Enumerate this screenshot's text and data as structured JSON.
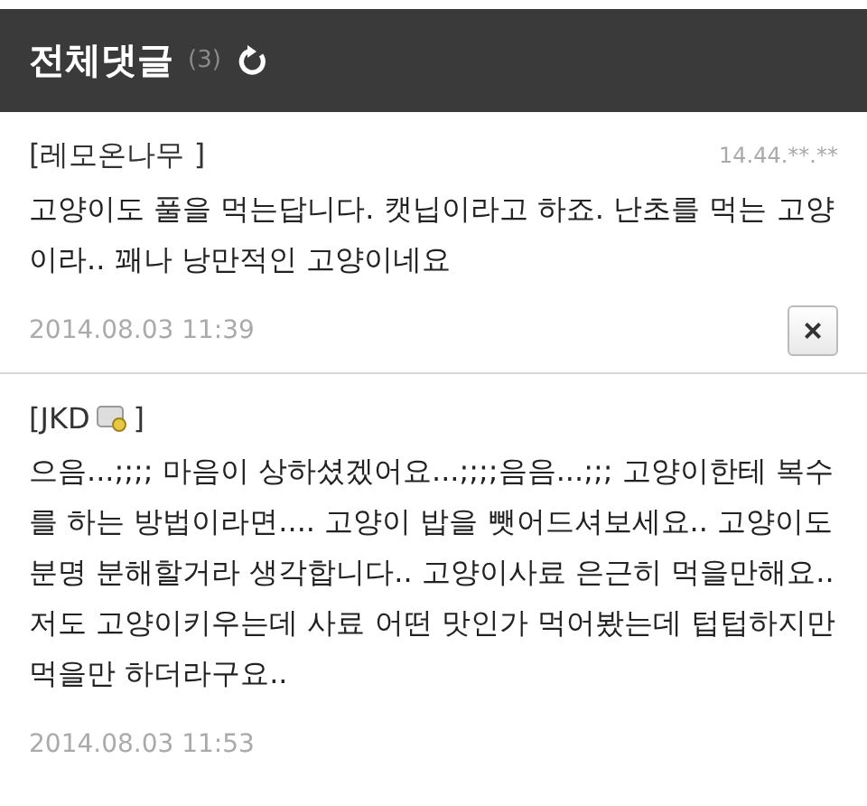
{
  "header": {
    "title": "전체댓글",
    "count": "(3)"
  },
  "comments": [
    {
      "author": "[레모온나무 ]",
      "badge": false,
      "ip": "14.44.**.**",
      "text": "고양이도 풀을 먹는답니다. 캣닙이라고 하죠. 난초를 먹는 고양이라.. 꽤나 낭만적인 고양이네요",
      "date": "2014.08.03 11:39",
      "deletable": true,
      "delete_label": "×"
    },
    {
      "author": "[JKD",
      "author_suffix": "]",
      "badge": true,
      "text": "으음...;;;; 마음이 상하셨겠어요...;;;;음음...;;; 고양이한테 복수를 하는 방법이라면.... 고양이 밥을 뺏어드셔보세요.. 고양이도 분명 분해할거라 생각합니다.. 고양이사료 은근히 먹을만해요.. 저도 고양이키우는데 사료 어떤 맛인가 먹어봤는데 텁텁하지만 먹을만 하더라구요..",
      "date": "2014.08.03 11:53",
      "deletable": false
    }
  ]
}
